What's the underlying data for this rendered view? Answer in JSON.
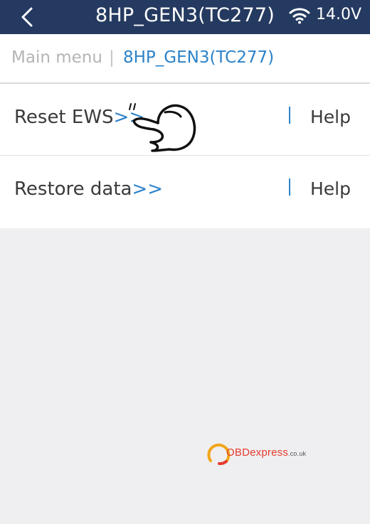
{
  "topbar": {
    "title": "8HP_GEN3(TC277)",
    "voltage": "14.0V",
    "back_icon": "chevron-left-icon",
    "wifi_icon": "wifi-icon",
    "bg_color": "#253a60"
  },
  "breadcrumb": {
    "main": "Main menu",
    "separator": "|",
    "current": "8HP_GEN3(TC277)"
  },
  "menu": {
    "items": [
      {
        "label": "Reset EWS",
        "arrow": ">>",
        "help": "Help"
      },
      {
        "label": "Restore data",
        "arrow": ">>",
        "help": "Help"
      }
    ]
  },
  "overlay": {
    "pointer_icon": "pointing-hand-icon"
  },
  "watermark": {
    "brand": "OBDexpress",
    "domain": ".co.uk"
  },
  "colors": {
    "accent": "#2b82c9",
    "background": "#efeff1"
  }
}
